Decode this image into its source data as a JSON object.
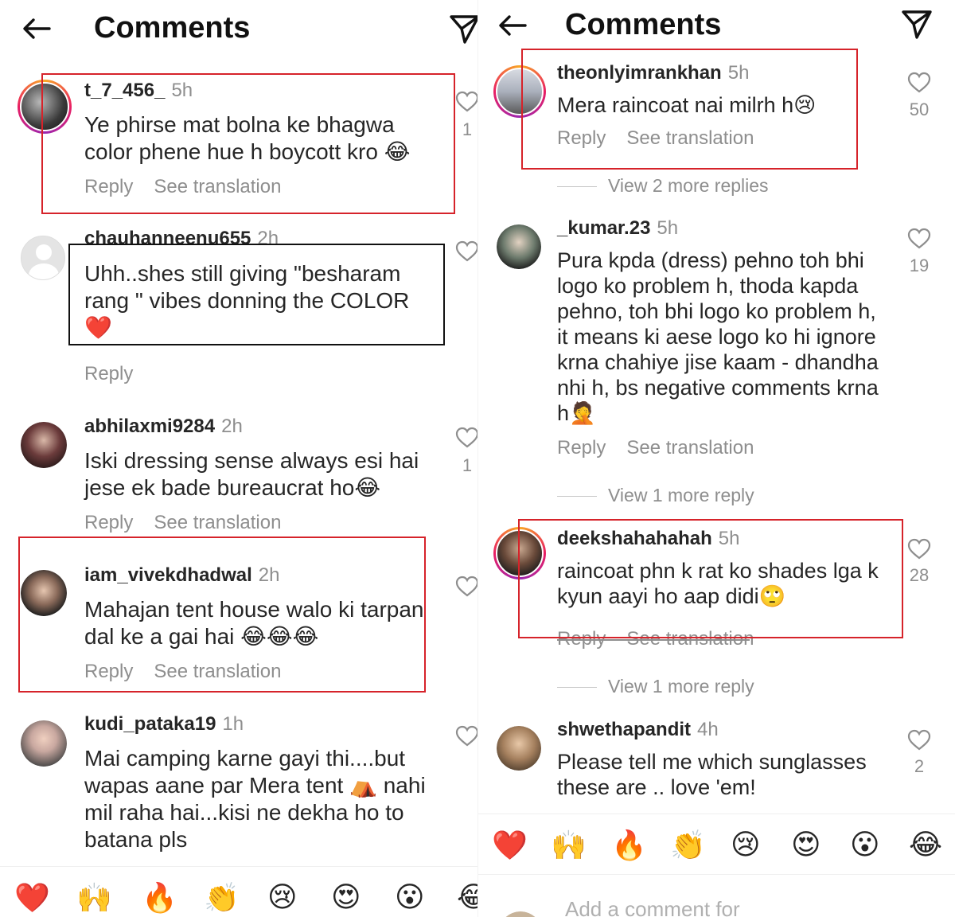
{
  "header": {
    "title": "Comments"
  },
  "left": {
    "comments": [
      {
        "username": "t_7_456_",
        "time": "5h",
        "text": "Ye phirse mat bolna ke bhagwa color phene hue h boycott kro 😂",
        "reply": "Reply",
        "translate": "See translation",
        "likes": "1"
      },
      {
        "username": "chauhanneenu655",
        "time": "2h",
        "text": "Uhh..shes still giving \"besharam rang \" vibes donning the COLOR ❤️",
        "reply": "Reply",
        "likes": ""
      },
      {
        "username": "abhilaxmi9284",
        "time": "2h",
        "text": "Iski dressing sense always esi hai jese ek bade bureaucrat ho😂",
        "reply": "Reply",
        "translate": "See translation",
        "likes": "1"
      },
      {
        "username": "iam_vivekdhadwal",
        "time": "2h",
        "text": "Mahajan tent house walo ki tarpan dal ke a gai hai 😂😂😂",
        "reply": "Reply",
        "translate": "See translation",
        "likes": ""
      },
      {
        "username": "kudi_pataka19",
        "time": "1h",
        "text": "Mai camping karne gayi thi....but wapas aane par Mera tent ⛺ nahi mil raha hai...kisi ne dekha ho to batana pls",
        "likes": ""
      }
    ],
    "emojis": [
      "❤️",
      "🙌",
      "🔥",
      "👏",
      "😢",
      "😍",
      "😮",
      "😂"
    ]
  },
  "right": {
    "comments": [
      {
        "username": "theonlyimrankhan",
        "time": "5h",
        "text": "Mera raincoat nai milrh h😢",
        "reply": "Reply",
        "translate": "See translation",
        "likes": "50",
        "view_more": "View 2 more replies"
      },
      {
        "username": "_kumar.23",
        "time": "5h",
        "text": "Pura kpda (dress) pehno toh bhi logo ko problem h, thoda kapda pehno, toh bhi logo ko problem h, it means ki aese logo ko hi ignore krna  chahiye jise kaam - dhandha nhi h, bs negative comments krna h🤦",
        "reply": "Reply",
        "translate": "See translation",
        "likes": "19",
        "view_more": "View 1 more reply"
      },
      {
        "username": "deekshahahahah",
        "time": "5h",
        "text": "raincoat phn k rat ko shades lga k kyun aayi ho aap didi🙄",
        "reply": "Reply",
        "translate": "See translation",
        "likes": "28",
        "view_more": "View 1 more reply"
      },
      {
        "username": "shwethapandit",
        "time": "4h",
        "text": "Please tell me which sunglasses these are .. love 'em!",
        "likes": "2"
      }
    ],
    "emojis": [
      "❤️",
      "🙌",
      "🔥",
      "👏",
      "😢",
      "😍",
      "😮",
      "😂"
    ],
    "add_comment_placeholder": "Add a comment for"
  },
  "icons": {
    "back": "arrow-left-icon",
    "send": "paper-plane-icon",
    "like": "heart-outline-icon"
  },
  "colors": {
    "highlight_red": "#d6232a",
    "highlight_black": "#111111",
    "secondary_text": "#8e8e8e"
  }
}
